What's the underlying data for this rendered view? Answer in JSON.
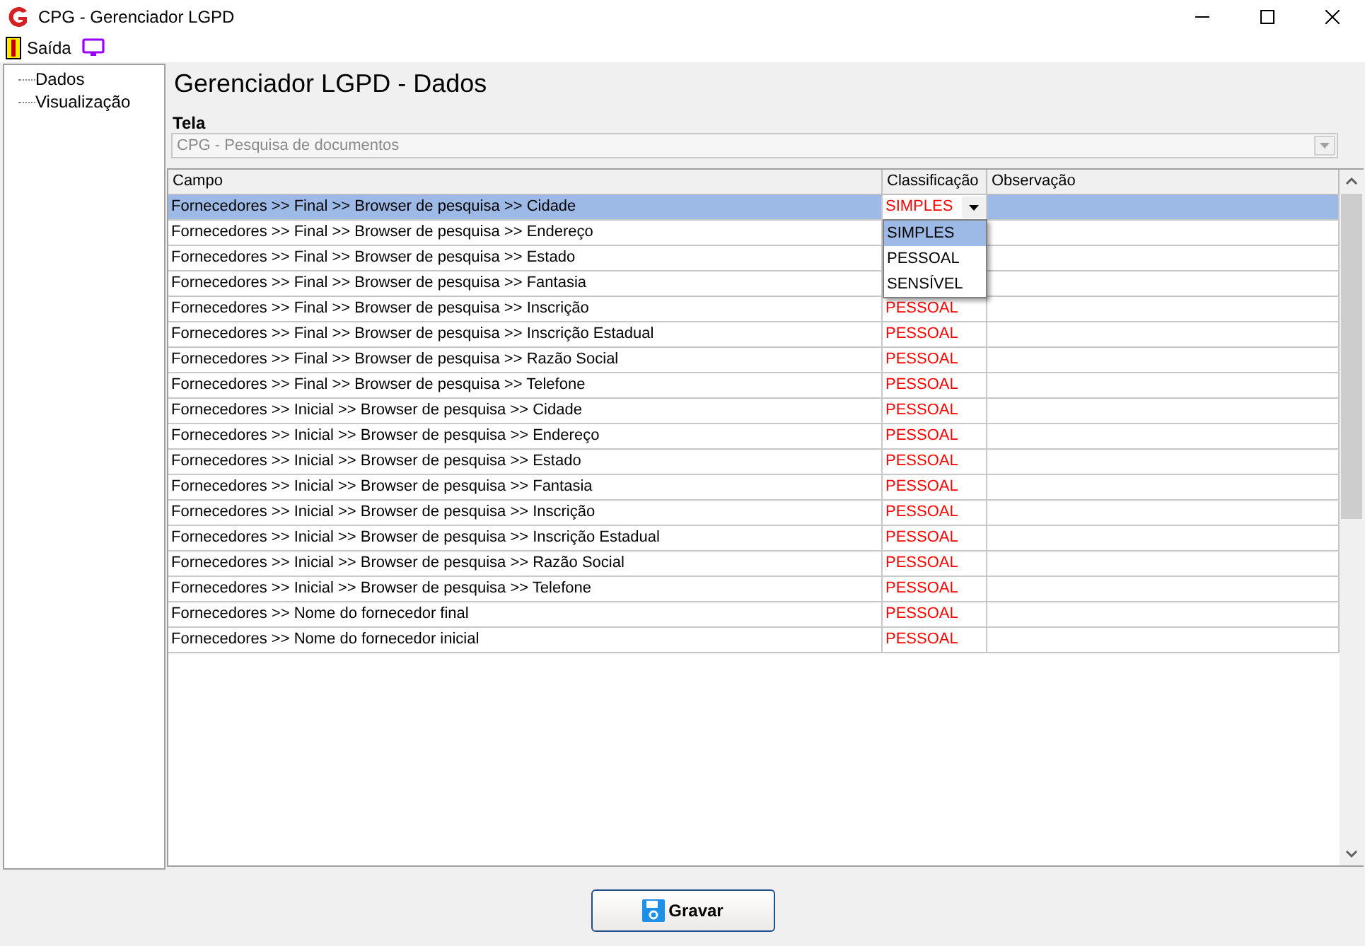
{
  "window": {
    "title": "CPG - Gerenciador LGPD"
  },
  "menu": [
    {
      "label": "Saída",
      "kind": "exit"
    },
    {
      "kind": "screen"
    }
  ],
  "tree": [
    {
      "label": "Dados"
    },
    {
      "label": "Visualização"
    }
  ],
  "heading": "Gerenciador LGPD - Dados",
  "tela": {
    "label": "Tela",
    "value": "CPG - Pesquisa de documentos"
  },
  "table": {
    "columns": [
      "Campo",
      "Classificação",
      "Observação"
    ],
    "rows": [
      {
        "campo": "Fornecedores >> Final >> Browser de pesquisa >> Cidade",
        "classificacao": "SIMPLES",
        "selected": true,
        "editing": true
      },
      {
        "campo": "Fornecedores >> Final >> Browser de pesquisa >> Endereço",
        "selected": false
      },
      {
        "campo": "Fornecedores >> Final >> Browser de pesquisa >> Estado",
        "selected": false
      },
      {
        "campo": "Fornecedores >> Final >> Browser de pesquisa >> Fantasia",
        "selected": false
      },
      {
        "campo": "Fornecedores >> Final >> Browser de pesquisa >> Inscrição",
        "classificacao": "PESSOAL",
        "selected": false
      },
      {
        "campo": "Fornecedores >> Final >> Browser de pesquisa >> Inscrição Estadual",
        "classificacao": "PESSOAL",
        "selected": false
      },
      {
        "campo": "Fornecedores >> Final >> Browser de pesquisa >> Razão Social",
        "classificacao": "PESSOAL",
        "selected": false
      },
      {
        "campo": "Fornecedores >> Final >> Browser de pesquisa >> Telefone",
        "classificacao": "PESSOAL",
        "selected": false
      },
      {
        "campo": "Fornecedores >> Inicial >> Browser de pesquisa >> Cidade",
        "classificacao": "PESSOAL",
        "selected": false
      },
      {
        "campo": "Fornecedores >> Inicial >> Browser de pesquisa >> Endereço",
        "classificacao": "PESSOAL",
        "selected": false
      },
      {
        "campo": "Fornecedores >> Inicial >> Browser de pesquisa >> Estado",
        "classificacao": "PESSOAL",
        "selected": false
      },
      {
        "campo": "Fornecedores >> Inicial >> Browser de pesquisa >> Fantasia",
        "classificacao": "PESSOAL",
        "selected": false
      },
      {
        "campo": "Fornecedores >> Inicial >> Browser de pesquisa >> Inscrição",
        "classificacao": "PESSOAL",
        "selected": false
      },
      {
        "campo": "Fornecedores >> Inicial >> Browser de pesquisa >> Inscrição Estadual",
        "classificacao": "PESSOAL",
        "selected": false
      },
      {
        "campo": "Fornecedores >> Inicial >> Browser de pesquisa >> Razão Social",
        "classificacao": "PESSOAL",
        "selected": false
      },
      {
        "campo": "Fornecedores >> Inicial >> Browser de pesquisa >> Telefone",
        "classificacao": "PESSOAL",
        "selected": false
      },
      {
        "campo": "Fornecedores >> Nome do fornecedor final",
        "classificacao": "PESSOAL",
        "selected": false
      },
      {
        "campo": "Fornecedores >> Nome do fornecedor inicial",
        "classificacao": "PESSOAL",
        "selected": false
      }
    ]
  },
  "dropdown": {
    "options": [
      {
        "label": "SIMPLES",
        "selected": true
      },
      {
        "label": "PESSOAL",
        "selected": false
      },
      {
        "label": "SENSÍVEL",
        "selected": false
      }
    ]
  },
  "save_button": "Gravar"
}
